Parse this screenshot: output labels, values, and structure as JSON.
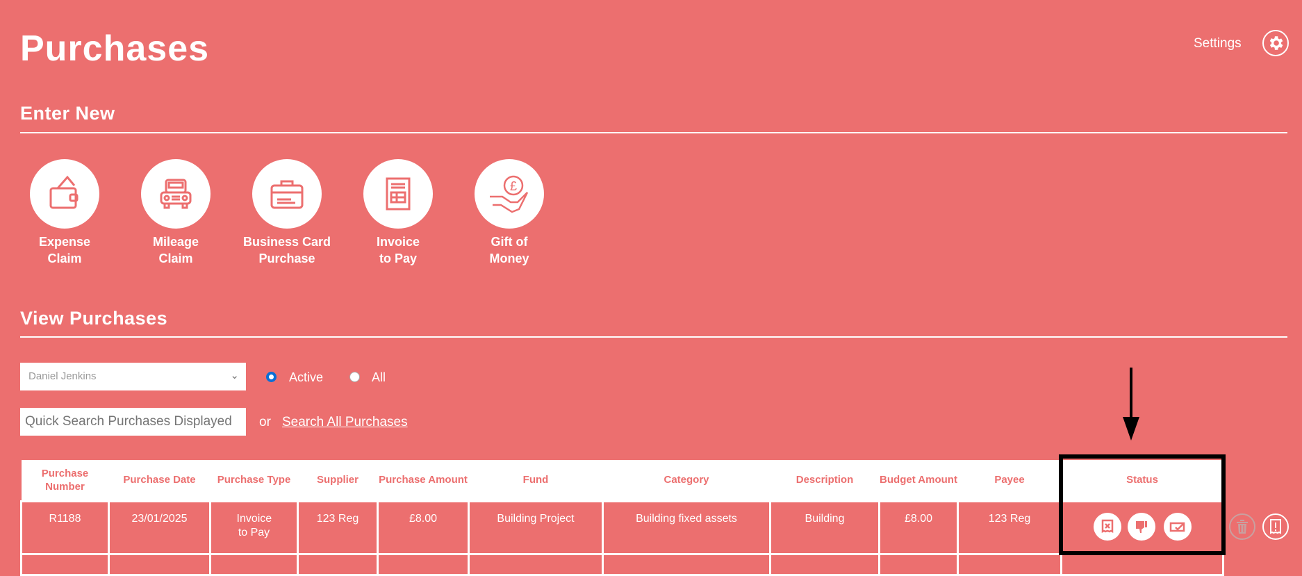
{
  "header": {
    "title": "Purchases",
    "settings_label": "Settings"
  },
  "enter_new": {
    "heading": "Enter New",
    "tiles": [
      {
        "line1": "Expense",
        "line2": "Claim",
        "icon": "wallet-icon"
      },
      {
        "line1": "Mileage",
        "line2": "Claim",
        "icon": "car-icon"
      },
      {
        "line1": "Business Card",
        "line2": "Purchase",
        "icon": "briefcase-card-icon"
      },
      {
        "line1": "Invoice",
        "line2": "to Pay",
        "icon": "invoice-icon"
      },
      {
        "line1": "Gift of",
        "line2": "Money",
        "icon": "hand-pound-coin-icon"
      }
    ]
  },
  "view": {
    "heading": "View Purchases",
    "user_select": "Daniel Jenkins",
    "radio_active": "Active",
    "radio_all": "All",
    "selected_filter": "Active",
    "search_placeholder": "Quick Search Purchases Displayed",
    "or_label": "or",
    "search_all_link": "Search All Purchases"
  },
  "table": {
    "columns": [
      "Purchase Number",
      "Purchase Date",
      "Purchase Type",
      "Supplier",
      "Purchase Amount",
      "Fund",
      "Category",
      "Description",
      "Budget Amount",
      "Payee",
      "Status"
    ],
    "rows": [
      {
        "number": "R1188",
        "date": "23/01/2025",
        "type": "Invoice to Pay",
        "supplier": "123 Reg",
        "amount": "£8.00",
        "fund": "Building Project",
        "category": "Building fixed assets",
        "description": "Building",
        "budget": "£8.00",
        "payee": "123 Reg"
      }
    ],
    "status_icons": [
      "reject-receipt-icon",
      "thumbs-down-icon",
      "payment-approved-icon"
    ],
    "row_actions": [
      "trash-icon",
      "receipt-alert-icon"
    ]
  },
  "colors": {
    "background": "#ec6f6f",
    "header_bg": "#ffffff",
    "annotation": "#000000"
  }
}
